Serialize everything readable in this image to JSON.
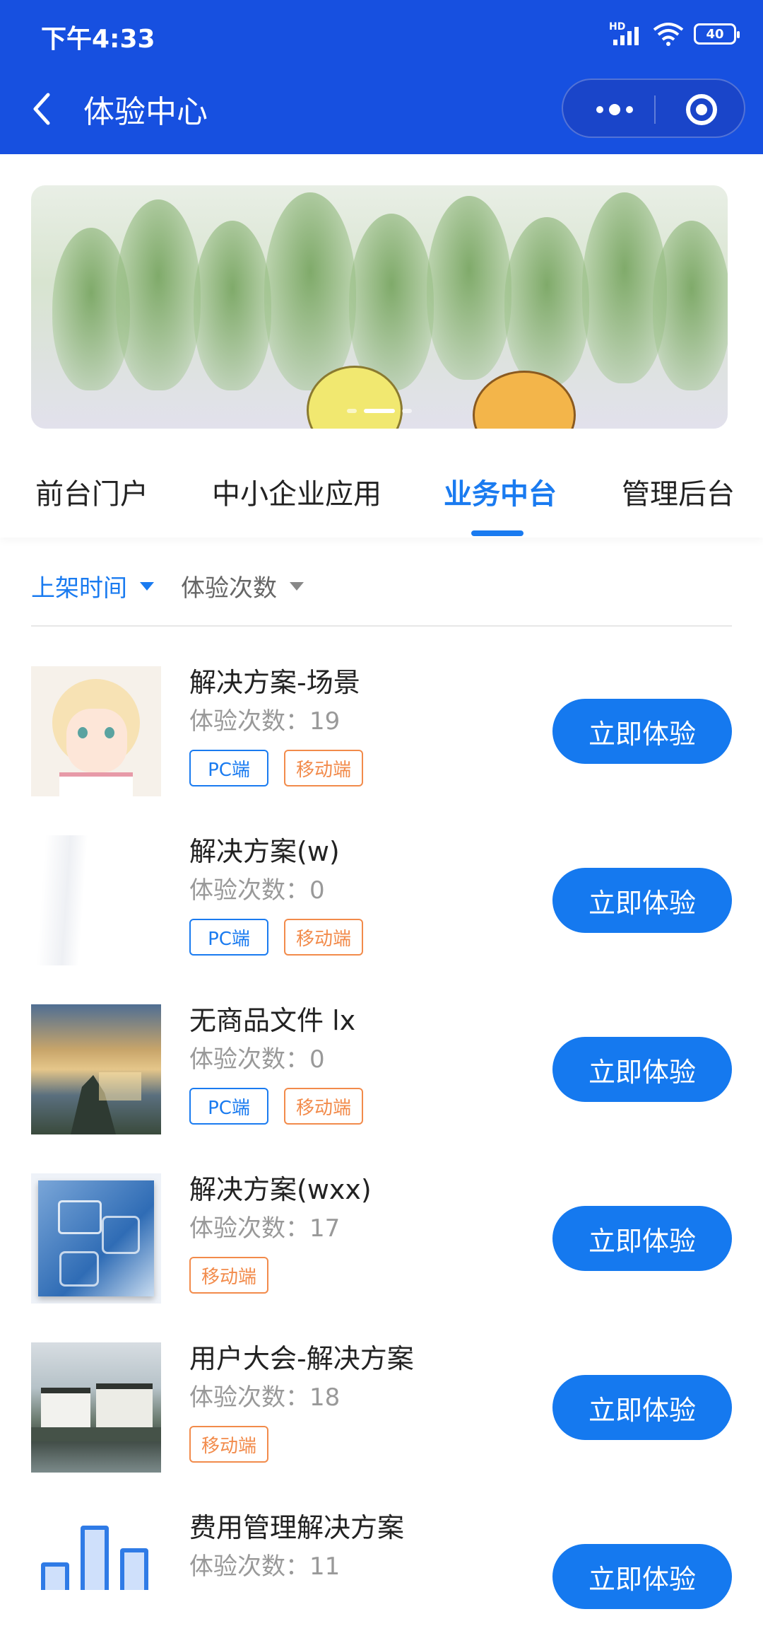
{
  "status": {
    "time": "下午4:33",
    "signal_label": "HD",
    "battery": "40"
  },
  "nav": {
    "title": "体验中心"
  },
  "tabs": [
    "前台门户",
    "中小企业应用",
    "业务中台",
    "管理后台"
  ],
  "active_tab": "业务中台",
  "sort": {
    "primary": "上架时间",
    "secondary": "体验次数"
  },
  "count_prefix": "体验次数：",
  "list": [
    {
      "name": "解决方案-场景",
      "count": "19",
      "tags": [
        "PC端",
        "移动端"
      ],
      "button": "立即体验",
      "thumb": "anime-girl-image"
    },
    {
      "name": "解决方案(w)",
      "count": "0",
      "tags": [
        "PC端",
        "移动端"
      ],
      "button": "立即体验",
      "thumb": "blank-image"
    },
    {
      "name": "无商品文件 lx",
      "count": "0",
      "tags": [
        "PC端",
        "移动端"
      ],
      "button": "立即体验",
      "thumb": "zelda-image"
    },
    {
      "name": "解决方案(wxx)",
      "count": "17",
      "tags": [
        "移动端"
      ],
      "button": "立即体验",
      "thumb": "hr-image"
    },
    {
      "name": "用户大会-解决方案",
      "count": "18",
      "tags": [
        "移动端"
      ],
      "button": "立即体验",
      "thumb": "village-image"
    },
    {
      "name": "费用管理解决方案",
      "count": "11",
      "tags": [],
      "button": "立即体验",
      "thumb": "bar-chart-image"
    }
  ],
  "colors": {
    "nav_bg": "#1750e0",
    "accent": "#1a7bf0",
    "button": "#1579ef",
    "tag_mobile": "#f28b4b"
  }
}
